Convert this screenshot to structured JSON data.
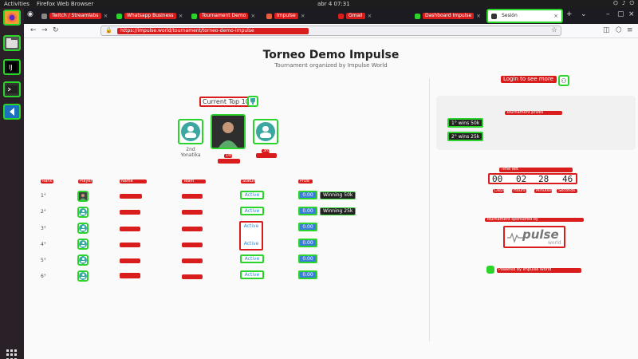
{
  "system": {
    "activities": "Activities",
    "app_name": "Firefox Web Browser",
    "clock": "abr 4  07:31"
  },
  "browser": {
    "tabs": [
      {
        "label": "Twitch / Streamlabs"
      },
      {
        "label": "Whatsapp Business"
      },
      {
        "label": "Tournament Demo"
      },
      {
        "label": "Impulse"
      },
      {
        "label": "Gmail"
      },
      {
        "label": "Dashboard Impulse"
      },
      {
        "label": "Sesión"
      }
    ],
    "url": "https://impulse.world/tournament/torneo-demo-impulse"
  },
  "page": {
    "title": "Torneo Demo Impulse",
    "subtitle": "Tournament organized by Impulse World",
    "leaderboard_title": "Current Top 10",
    "podium": [
      {
        "place": "2nd",
        "name": "Yonatika"
      },
      {
        "place": "1st",
        "name": ""
      },
      {
        "place": "3rd",
        "name": ""
      }
    ],
    "table_headers": [
      "Rank",
      "Player",
      "Name",
      "Team",
      "Status",
      "Prize"
    ],
    "rows": [
      {
        "rank": "1°",
        "status": "Active",
        "amount": "0.00",
        "badge": "Winning 50k"
      },
      {
        "rank": "2°",
        "status": "Active",
        "amount": "0.00",
        "badge": "Winning 25k"
      },
      {
        "rank": "3°",
        "status": "Active",
        "amount": "0.00",
        "badge": ""
      },
      {
        "rank": "4°",
        "status": "Active",
        "amount": "0.00",
        "badge": ""
      },
      {
        "rank": "5°",
        "status": "Active",
        "amount": "0.00",
        "badge": ""
      },
      {
        "rank": "6°",
        "status": "Active",
        "amount": "0.00",
        "badge": ""
      }
    ]
  },
  "sidebar": {
    "login_label": "Login to see more",
    "prizes_title": "Tournament prizes",
    "prizes": [
      "1° wins 50k",
      "2° wins 25k"
    ],
    "timer_title": "Time left",
    "timer": [
      {
        "value": "00",
        "unit": "Days"
      },
      {
        "value": "02",
        "unit": "Hours"
      },
      {
        "value": "28",
        "unit": "Minutes"
      },
      {
        "value": "46",
        "unit": "Seconds"
      }
    ],
    "sponsor_title": "Tournament sponsored by",
    "sponsor_logo": "pulse",
    "sponsor_logo_sub": "world",
    "footer_link": "Powered by Impulse World"
  },
  "colors": {
    "accent_green": "#2bd42b",
    "accent_red": "#d91c1c",
    "teal": "#3aa8a0",
    "blue": "#3b7dd8"
  }
}
